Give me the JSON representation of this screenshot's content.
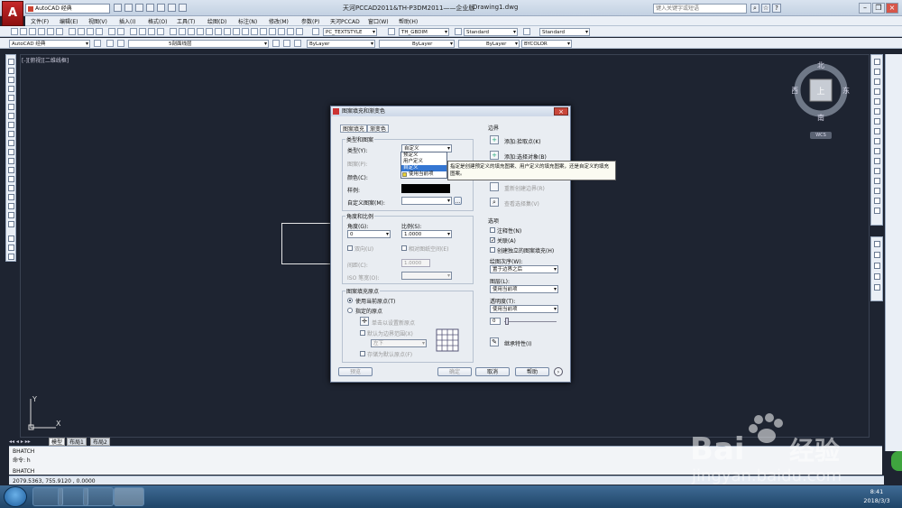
{
  "titlebar": {
    "workspace": "AutoCAD 经典",
    "title": "天河PCCAD2011&TH-P3DM2011——企业版",
    "file": "Drawing1.dwg",
    "search_placeholder": "键入关键字或短语"
  },
  "menu": [
    "文件(F)",
    "编辑(E)",
    "视图(V)",
    "插入(I)",
    "格式(O)",
    "工具(T)",
    "绘图(D)",
    "标注(N)",
    "修改(M)",
    "参数(P)",
    "天河PCCAD",
    "窗口(W)",
    "帮助(H)"
  ],
  "toolbar": {
    "text_style": "PC_TEXTSTYLE",
    "dim_style": "TH_GBDIM",
    "table_style": "Standard",
    "mleader_style": "Standard",
    "workspace2": "AutoCAD 经典",
    "layer": "5剖面线层",
    "color": "ByLayer",
    "linetype": "ByLayer",
    "lineweight": "ByLayer",
    "plotstyle": "BYCOLOR"
  },
  "viewport_label": "[-][俯视][二维线框]",
  "viewcube": {
    "north": "北",
    "south": "南",
    "east": "东",
    "west": "西",
    "top": "上",
    "wcs": "WCS"
  },
  "ucs": {
    "x": "X",
    "y": "Y"
  },
  "tabs": {
    "model": "模型",
    "layout1": "布局1",
    "layout2": "布局2"
  },
  "command": {
    "line1": "BHATCH",
    "line2": "命令: h",
    "line3": "BHATCH"
  },
  "status_coords": "2079.5363, 755.9120 , 0.0000",
  "clock": {
    "time": "8:41",
    "date": "2018/3/3"
  },
  "dialog": {
    "title": "图案填充和渐变色",
    "tab_hatch": "图案填充",
    "tab_gradient": "渐变色",
    "type_pattern_group": "类型和图案",
    "type_label": "类型(Y):",
    "type_value": "自定义",
    "pattern_label": "图案(P):",
    "color_label": "颜色(C):",
    "sample_label": "样例:",
    "custom_pattern_label": "自定义图案(M):",
    "angle_scale_group": "角度和比例",
    "angle_label": "角度(G):",
    "angle_value": "0",
    "scale_label": "比例(S):",
    "scale_value": "1.0000",
    "double_label": "双向(U)",
    "relative_label": "相对图纸空间(E)",
    "spacing_label": "间距(C):",
    "spacing_value": "1.0000",
    "iso_label": "ISO 笔宽(O):",
    "origin_group": "图案填充原点",
    "use_current_origin": "使用当前原点(T)",
    "specified_origin": "指定的原点",
    "click_set_origin": "单击以设置新原点",
    "default_boundary": "默认为边界范围(X)",
    "origin_pos": "左下",
    "store_default": "存储为默认原点(F)",
    "boundary_group": "边界",
    "add_pick": "添加:拾取点(K)",
    "add_select": "添加:选择对象(B)",
    "recreate_boundary": "重新创建边界(R)",
    "view_selection": "查看选择集(V)",
    "options_group": "选项",
    "annotative": "注释性(N)",
    "associative": "关联(A)",
    "create_separate": "创建独立的图案填充(H)",
    "draw_order_label": "绘图次序(W):",
    "draw_order_value": "置于边界之后",
    "layer_label": "图层(L):",
    "layer_value": "使用当前项",
    "transparency_label": "透明度(T):",
    "transparency_value": "使用当前项",
    "transparency_num": "0",
    "inherit": "继承特性(I)",
    "btn_preview": "预览",
    "btn_ok": "确定",
    "btn_cancel": "取消",
    "btn_help": "帮助"
  },
  "dropdown_options": [
    "预定义",
    "用户定义",
    "自定义",
    "使用当前项"
  ],
  "tooltip": "指定是创建预定义的填充图案、用户定义的填充图案，还是自定义的填充图案。",
  "watermark": {
    "brand": "Bai",
    "brand2": "经验",
    "url": "jingyan.baidu.com"
  }
}
